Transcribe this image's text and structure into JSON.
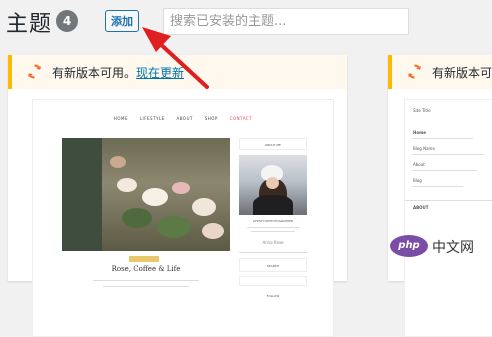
{
  "header": {
    "title": "主题",
    "theme_count": "4",
    "add_label": "添加",
    "search_placeholder": "搜索已安装的主题..."
  },
  "themes": [
    {
      "update_notice": "有新版本可用。",
      "update_link": "现在更新",
      "preview": {
        "nav_items": [
          "HOME",
          "LIFESTYLE",
          "ABOUT",
          "SHOP",
          "CONTACT"
        ],
        "post_title": "Rose, Coffee & Life",
        "sidebar_title": "ABOUT ME",
        "author_name": "LIFESTYLEPHOTOGRAPHER",
        "signature": "Anna Rose",
        "widget_title": "SEARCH",
        "follow_title": "FOLLOW"
      }
    },
    {
      "update_notice": "有新版本可",
      "preview": {
        "site_title": "Site Title",
        "items": [
          "Home",
          "Blog Name",
          "About",
          "Blog"
        ],
        "footer_label": "ABOUT"
      }
    }
  ],
  "watermark": {
    "logo": "php",
    "text": "中文网"
  },
  "colors": {
    "accent": "#2271b1",
    "notice_border": "#ffb900",
    "update_icon": "#f56e28",
    "arrow": "#e02020"
  }
}
